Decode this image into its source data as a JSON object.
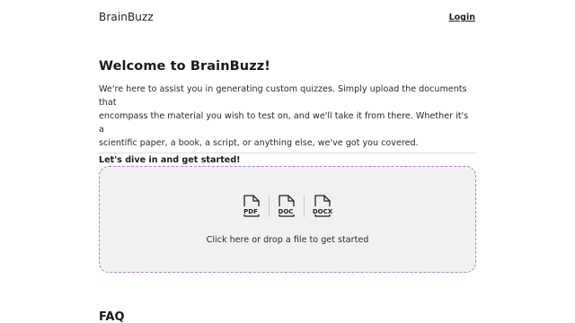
{
  "header": {
    "brand": "BrainBuzz",
    "login_label": "Login"
  },
  "welcome": {
    "title": "Welcome to BrainBuzz!",
    "intro_line1": "We're here to assist you in generating custom quizzes. Simply upload the documents that",
    "intro_line2": "encompass the material you wish to test on, and we'll take it from there. Whether it's a",
    "intro_line3": "scientific paper, a book, a script, or anything else, we've got you covered.",
    "cta": "Let's dive in and get started!"
  },
  "upload": {
    "file_types": [
      {
        "label": "PDF",
        "icon": "pdf-file-icon"
      },
      {
        "label": "DOC",
        "icon": "doc-file-icon"
      },
      {
        "label": "DOCX",
        "icon": "docx-file-icon"
      }
    ],
    "instruction": "Click here or drop a file to get started",
    "border_color": "#b57fd6",
    "background_color": "#f1f1f1"
  },
  "faq": {
    "heading": "FAQ"
  }
}
